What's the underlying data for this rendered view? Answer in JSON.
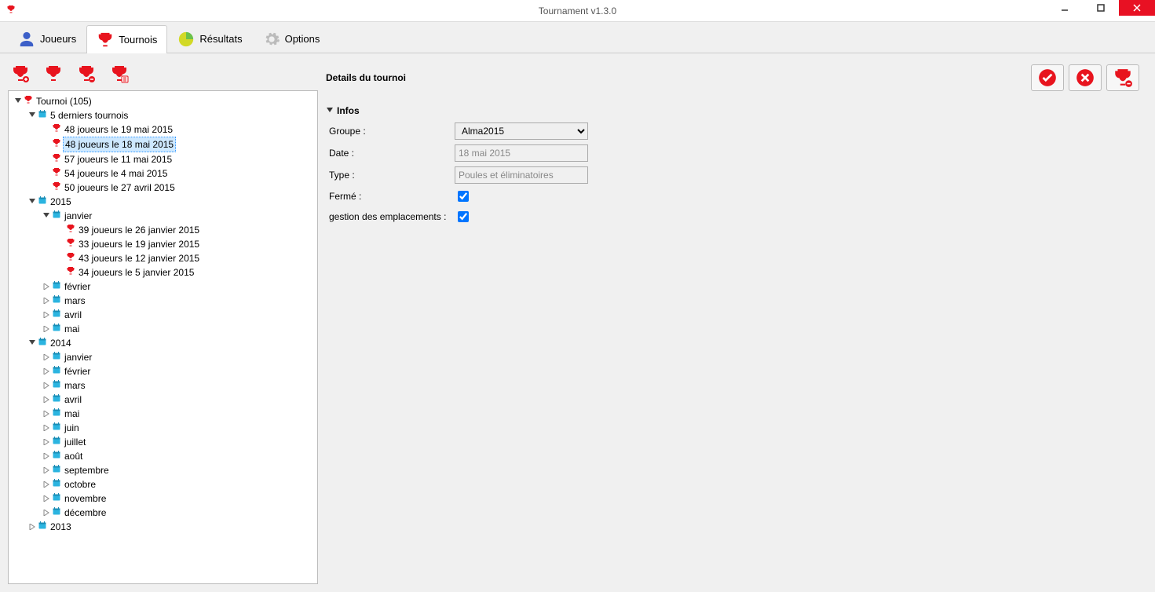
{
  "window": {
    "title": "Tournament v1.3.0"
  },
  "tabs": {
    "joueurs": "Joueurs",
    "tournois": "Tournois",
    "resultats": "Résultats",
    "options": "Options",
    "active": "tournois"
  },
  "tree": {
    "root": "Tournoi (105)",
    "recent": {
      "label": "5 derniers tournois",
      "items": [
        "48 joueurs le 19 mai 2015",
        "48 joueurs le 18 mai 2015",
        "57 joueurs le 11 mai 2015",
        "54 joueurs le 4 mai 2015",
        "50 joueurs le 27 avril 2015"
      ],
      "selected_index": 1
    },
    "y2015": {
      "label": "2015",
      "janvier": {
        "label": "janvier",
        "items": [
          "39 joueurs le 26 janvier 2015",
          "33 joueurs le 19 janvier 2015",
          "43 joueurs le 12 janvier 2015",
          "34 joueurs le 5 janvier 2015"
        ]
      },
      "months": [
        "février",
        "mars",
        "avril",
        "mai"
      ]
    },
    "y2014": {
      "label": "2014",
      "months": [
        "janvier",
        "février",
        "mars",
        "avril",
        "mai",
        "juin",
        "juillet",
        "août",
        "septembre",
        "octobre",
        "novembre",
        "décembre"
      ]
    },
    "y2013": {
      "label": "2013"
    }
  },
  "details": {
    "title": "Details du tournoi",
    "section_infos": "Infos",
    "labels": {
      "groupe": "Groupe :",
      "date": "Date :",
      "type": "Type :",
      "ferme": "Fermé :",
      "emplacements": "gestion des emplacements :"
    },
    "values": {
      "groupe": "Alma2015",
      "date": "18 mai 2015",
      "type": "Poules et éliminatoires",
      "ferme": true,
      "emplacements": true
    }
  }
}
